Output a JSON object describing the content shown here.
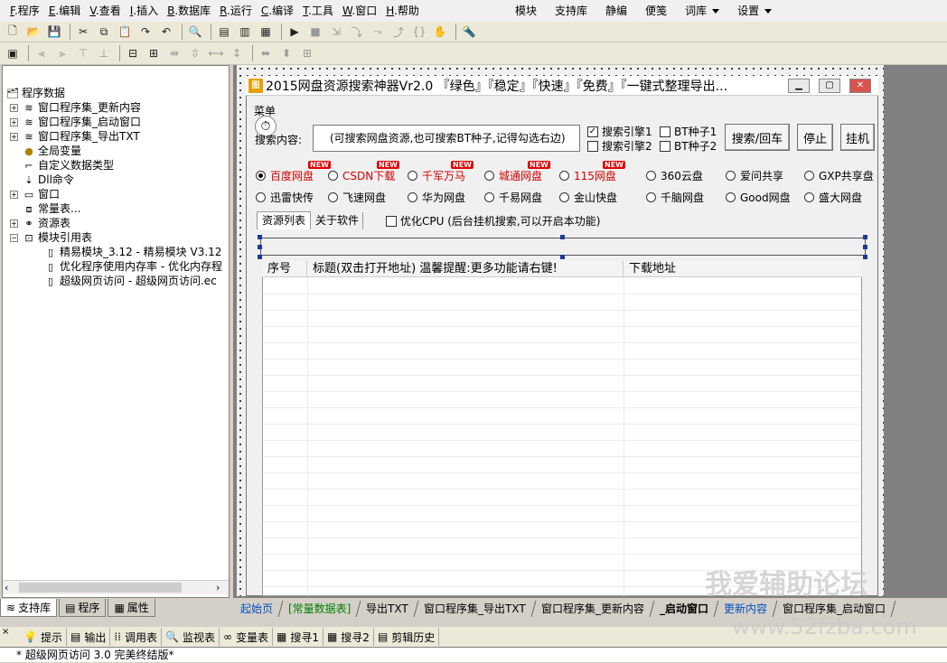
{
  "menu": {
    "left": [
      {
        "key": "F",
        "label": ".程序"
      },
      {
        "key": "E",
        "label": ".编辑"
      },
      {
        "key": "V",
        "label": ".查看"
      },
      {
        "key": "I",
        "label": ".插入"
      },
      {
        "key": "B",
        "label": ".数据库"
      },
      {
        "key": "R",
        "label": ".运行"
      },
      {
        "key": "C",
        "label": ".编译"
      },
      {
        "key": "T",
        "label": ".工具"
      },
      {
        "key": "W",
        "label": ".窗口"
      },
      {
        "key": "H",
        "label": ".帮助"
      }
    ],
    "right": [
      "模块",
      "支持库",
      "静编",
      "便笺",
      "词库",
      "设置"
    ]
  },
  "tree": {
    "root": "程序数据",
    "items": [
      "窗口程序集_更新内容",
      "窗口程序集_启动窗口",
      "窗口程序集_导出TXT",
      "全局变量",
      "自定义数据类型",
      "Dll命令",
      "窗口",
      "常量表...",
      "资源表",
      "模块引用表",
      "精易模块_3.12 - 精易模块 V3.12",
      "优化程序使用内存率 - 优化内存程",
      "超级网页访问 - 超级网页访问.ec"
    ]
  },
  "left_tabs": [
    "支持库",
    "程序",
    "属性"
  ],
  "window": {
    "title": "2015网盘资源搜索神器Vr2.0 『绿色』『稳定』『快速』『免费』『一键式整理导出...",
    "menu_label": "菜单",
    "search_label": "搜索内容:",
    "search_placeholder": "(可搜索网盘资源,也可搜索BT种子,记得勾选右边)",
    "checks": [
      {
        "label": "搜索引擎1",
        "checked": true
      },
      {
        "label": "BT种子1",
        "checked": false
      },
      {
        "label": "搜索引擎2",
        "checked": false
      },
      {
        "label": "BT种子2",
        "checked": false
      }
    ],
    "buttons": [
      "搜索/回车",
      "停止",
      "挂机"
    ],
    "radios_row1": [
      {
        "label": "百度网盘",
        "selected": true,
        "red": true,
        "new": true
      },
      {
        "label": "CSDN下载",
        "selected": false,
        "red": true,
        "new": true
      },
      {
        "label": "千军万马",
        "selected": false,
        "red": true,
        "new": true
      },
      {
        "label": "城通网盘",
        "selected": false,
        "red": true,
        "new": true
      },
      {
        "label": "115网盘",
        "selected": false,
        "red": true,
        "new": true
      },
      {
        "label": "360云盘",
        "selected": false,
        "red": false,
        "new": false
      },
      {
        "label": "爱问共享",
        "selected": false,
        "red": false,
        "new": false
      },
      {
        "label": "GXP共享盘",
        "selected": false,
        "red": false,
        "new": false
      }
    ],
    "radios_row2": [
      "迅雷快传",
      "飞速网盘",
      "华为网盘",
      "千易网盘",
      "金山快盘",
      "千脑网盘",
      "Good网盘",
      "盛大网盘"
    ],
    "new_badge": "NEW",
    "tabs": [
      "资源列表",
      "关于软件"
    ],
    "cpu_check": "优化CPU (后台挂机搜索,可以开启本功能)",
    "columns": [
      "序号",
      "标题(双击打开地址) 温馨提醒:更多功能请右键!",
      "下载地址"
    ]
  },
  "designer_tabs": [
    "起始页",
    "[常量数据表]",
    "导出TXT",
    "窗口程序集_导出TXT",
    "窗口程序集_更新内容",
    "_启动窗口",
    "更新内容",
    "窗口程序集_启动窗口"
  ],
  "output_tabs": [
    "提示",
    "输出",
    "调用表",
    "监视表",
    "变量表",
    "搜寻1",
    "搜寻2",
    "剪辑历史"
  ],
  "status": "* 超级网页访问 3.0 完美终结版*",
  "watermark": {
    "line1": "我爱辅助论坛",
    "line2": "www.52fzba.com"
  }
}
